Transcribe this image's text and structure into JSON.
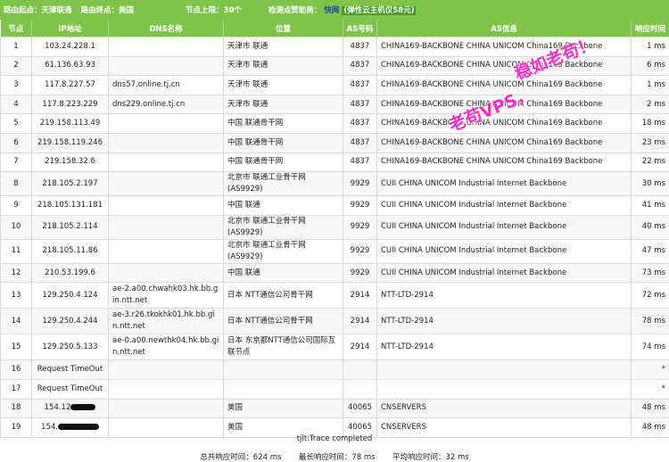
{
  "header": {
    "origin_label": "路由起点：天津联通",
    "dest_label": "路由终点：美国",
    "hop_limit_label": "节点上限：",
    "hop_limit": "30个",
    "sponsor_label": "检测点赞助商：",
    "sponsor_name": "快网",
    "sponsor_promo": "(弹性云主机仅58元)"
  },
  "table": {
    "columns": [
      "节点",
      "IP地址",
      "DNS名称",
      "位置",
      "AS号码",
      "AS信息",
      "响应时间"
    ],
    "rows": [
      {
        "hop": "1",
        "ip": "103.24.228.1",
        "dns": "",
        "loc": "天津市 联通",
        "as": "4837",
        "asinfo": "CHINA169-BACKBONE CHINA UNICOM China169 Backbone",
        "time": "1 ms"
      },
      {
        "hop": "2",
        "ip": "61.136.63.93",
        "dns": "",
        "loc": "天津市 联通",
        "as": "4837",
        "asinfo": "CHINA169-BACKBONE CHINA UNICOM China169 Backbone",
        "time": "6 ms"
      },
      {
        "hop": "3",
        "ip": "117.8.227.57",
        "dns": "dns57.online.tj.cn",
        "loc": "天津市 联通",
        "as": "4837",
        "asinfo": "CHINA169-BACKBONE CHINA UNICOM China169 Backbone",
        "time": "1 ms"
      },
      {
        "hop": "4",
        "ip": "117.8.223.229",
        "dns": "dns229.online.tj.cn",
        "loc": "天津市 联通",
        "as": "4837",
        "asinfo": "CHINA169-BACKBONE CHINA UNICOM China169 Backbone",
        "time": "2 ms"
      },
      {
        "hop": "5",
        "ip": "219.158.113.49",
        "dns": "",
        "loc": "中国 联通骨干网",
        "as": "4837",
        "asinfo": "CHINA169-BACKBONE CHINA UNICOM China169 Backbone",
        "time": "18 ms"
      },
      {
        "hop": "6",
        "ip": "219.158.119.246",
        "dns": "",
        "loc": "中国 联通骨干网",
        "as": "4837",
        "asinfo": "CHINA169-BACKBONE CHINA UNICOM China169 Backbone",
        "time": "23 ms"
      },
      {
        "hop": "7",
        "ip": "219.158.32.6",
        "dns": "",
        "loc": "中国 联通骨干网",
        "as": "4837",
        "asinfo": "CHINA169-BACKBONE CHINA UNICOM China169 Backbone",
        "time": "22 ms"
      },
      {
        "hop": "8",
        "ip": "218.105.2.197",
        "dns": "",
        "loc": "北京市 联通工业骨干网(AS9929)",
        "as": "9929",
        "asinfo": "CUII CHINA UNICOM Industrial Internet Backbone",
        "time": "30 ms"
      },
      {
        "hop": "9",
        "ip": "218.105.131.181",
        "dns": "",
        "loc": "中国 联通",
        "as": "9929",
        "asinfo": "CUII CHINA UNICOM Industrial Internet Backbone",
        "time": "41 ms"
      },
      {
        "hop": "10",
        "ip": "218.105.2.114",
        "dns": "",
        "loc": "北京市 联通工业骨干网(AS9929)",
        "as": "9929",
        "asinfo": "CUII CHINA UNICOM Industrial Internet Backbone",
        "time": "40 ms"
      },
      {
        "hop": "11",
        "ip": "218.105.11.86",
        "dns": "",
        "loc": "北京市 联通工业骨干网(AS9929)",
        "as": "9929",
        "asinfo": "CUII CHINA UNICOM Industrial Internet Backbone",
        "time": "47 ms"
      },
      {
        "hop": "12",
        "ip": "210.53.199.6",
        "dns": "",
        "loc": "中国 联通",
        "as": "9929",
        "asinfo": "CUII CHINA UNICOM Industrial Internet Backbone",
        "time": "73 ms"
      },
      {
        "hop": "13",
        "ip": "129.250.4.124",
        "dns": "ae-2.a00.chwahk03.hk.bb.gin.ntt.net",
        "loc": "日本 NTT通信公司骨干网",
        "as": "2914",
        "asinfo": "NTT-LTD-2914",
        "time": "72 ms"
      },
      {
        "hop": "14",
        "ip": "129.250.4.244",
        "dns": "ae-3.r26.tkokhk01.hk.bb.gin.ntt.net",
        "loc": "日本 NTT通信公司骨干网",
        "as": "2914",
        "asinfo": "NTT-LTD-2914",
        "time": "78 ms"
      },
      {
        "hop": "15",
        "ip": "129.250.5.133",
        "dns": "ae-0.a00.newthk04.hk.bb.gin.ntt.net",
        "loc": "日本 东京都NTT通信公司国际互联节点",
        "as": "2914",
        "asinfo": "NTT-LTD-2914",
        "time": "74 ms"
      },
      {
        "hop": "16",
        "ip": "Request TimeOut",
        "dns": "",
        "loc": "",
        "as": "",
        "asinfo": "",
        "time": "*"
      },
      {
        "hop": "17",
        "ip": "Request TimeOut",
        "dns": "",
        "loc": "",
        "as": "",
        "asinfo": "",
        "time": "*"
      },
      {
        "hop": "18",
        "ip": "154.12",
        "dns": "",
        "loc": "美国",
        "as": "40065",
        "asinfo": "CNSERVERS",
        "time": "48 ms"
      },
      {
        "hop": "19",
        "ip": "154.",
        "dns": "",
        "loc": "美国",
        "as": "40065",
        "asinfo": "CNSERVERS",
        "time": "48 ms"
      }
    ]
  },
  "watermark": {
    "line1": "老苟VPS，",
    "line2": "稳如老苟！"
  },
  "footer": {
    "status": "tjlt:Trace completed",
    "total_label": "总共响应时间：",
    "total_value": "624 ms",
    "max_label": "最长响应时间：",
    "max_value": "78 ms",
    "avg_label": "平均响应时间：",
    "avg_value": "32 ms"
  }
}
